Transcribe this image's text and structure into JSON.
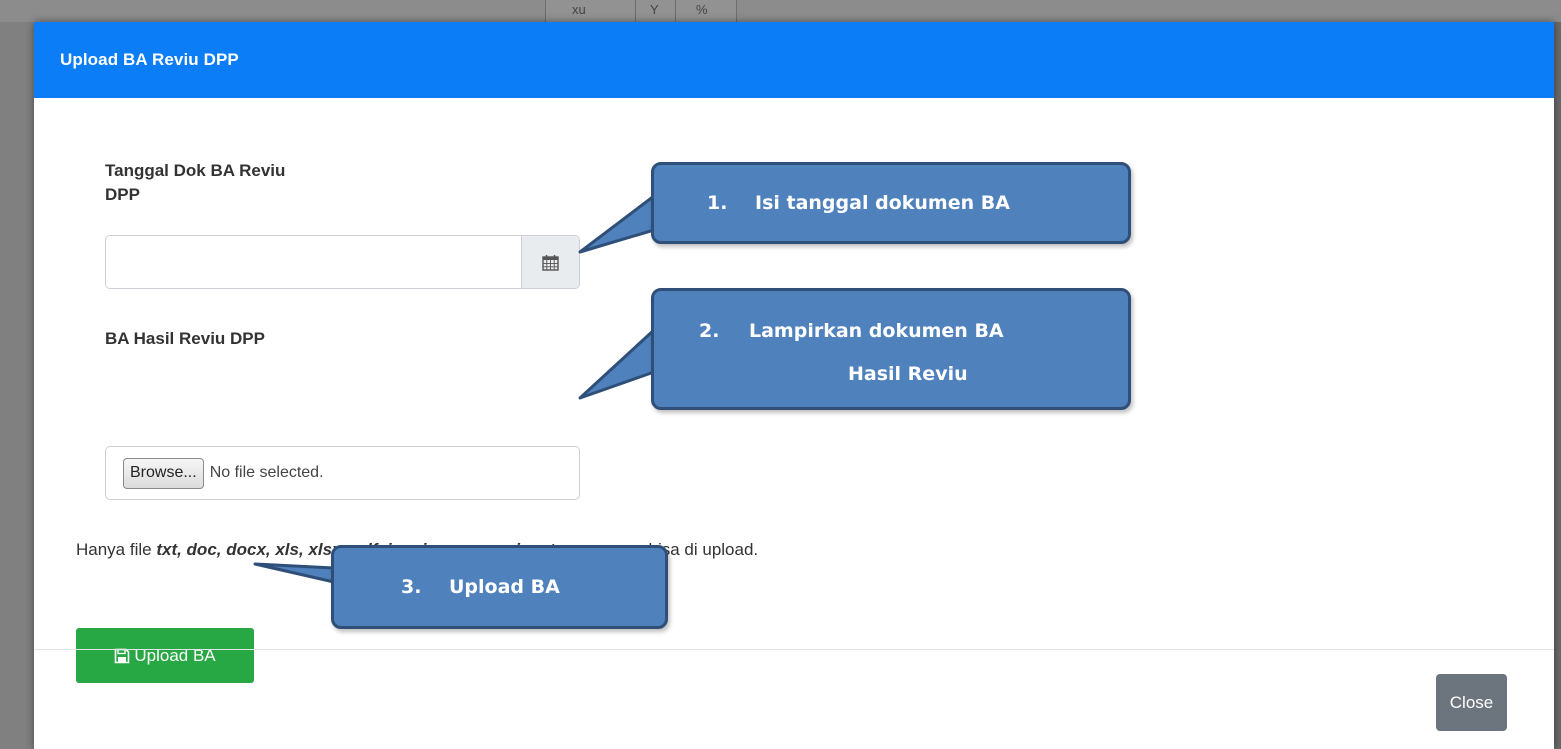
{
  "modal": {
    "title": "Upload BA Reviu DPP",
    "date_label_line1": "Tanggal Dok BA Reviu",
    "date_label_line2": "DPP",
    "date_value": "",
    "file_label": "BA Hasil Reviu DPP",
    "browse_label": "Browse...",
    "file_status": "No file selected.",
    "hint_prefix": "Hanya file ",
    "hint_types": "txt, doc, docx, xls, xlsx, pdf, jpg, jpeg, png, zip, atau rar",
    "hint_suffix": " yang bisa di upload.",
    "upload_label": "Upload BA",
    "close_label": "Close"
  },
  "callouts": {
    "c1_num": "1.",
    "c1_text": "Isi tanggal dokumen BA",
    "c2_num": "2.",
    "c2_line1": "Lampirkan dokumen BA",
    "c2_line2": "Hasil Reviu",
    "c3_num": "3.",
    "c3_text": "Upload BA"
  },
  "background": {
    "topbar_text1": "xu",
    "topbar_text2": "Y",
    "topbar_text3": "%"
  },
  "colors": {
    "header": "#0a7df7",
    "upload_button": "#28a745",
    "close_button": "#6c757d",
    "callout_fill": "#4f81bd",
    "callout_border": "#2f4f78"
  },
  "icons": {
    "calendar": "calendar-icon",
    "save": "floppy-disk-icon"
  }
}
